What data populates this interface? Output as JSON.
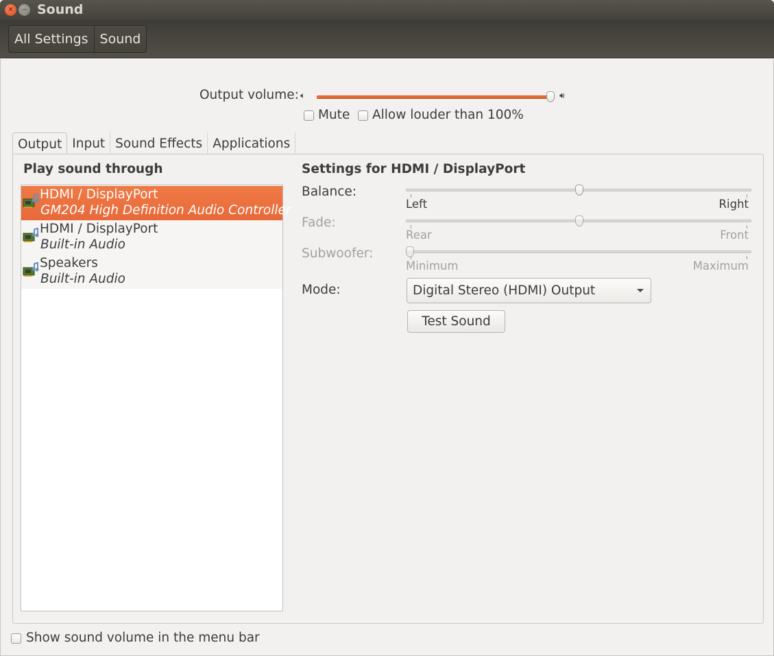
{
  "window": {
    "title": "Sound",
    "close_icon": "close-icon",
    "minimize_icon": "minimize-icon"
  },
  "toolbar": {
    "breadcrumbs": [
      "All Settings",
      "Sound"
    ]
  },
  "volume": {
    "label": "Output volume:",
    "value_percent": 100,
    "low_icon": "speaker-low-icon",
    "high_icon": "speaker-high-icon",
    "mute_label": "Mute",
    "mute_checked": false,
    "allow_louder_label": "Allow louder than 100%",
    "allow_louder_checked": false
  },
  "tabs": [
    {
      "label": "Output",
      "active": true
    },
    {
      "label": "Input",
      "active": false
    },
    {
      "label": "Sound Effects",
      "active": false
    },
    {
      "label": "Applications",
      "active": false
    }
  ],
  "output": {
    "list_heading": "Play sound through",
    "devices": [
      {
        "name": "HDMI / DisplayPort",
        "description": "GM204 High Definition Audio Controller",
        "selected": true,
        "icon": "sound-card-icon"
      },
      {
        "name": "HDMI / DisplayPort",
        "description": "Built-in Audio",
        "selected": false,
        "icon": "sound-card-icon"
      },
      {
        "name": "Speakers",
        "description": "Built-in Audio",
        "selected": false,
        "icon": "sound-card-icon"
      }
    ],
    "settings_heading": "Settings for HDMI / DisplayPort",
    "balance": {
      "label": "Balance:",
      "min_label": "Left",
      "max_label": "Right",
      "value_fraction": 0.5,
      "enabled": true
    },
    "fade": {
      "label": "Fade:",
      "min_label": "Rear",
      "max_label": "Front",
      "value_fraction": 0.5,
      "enabled": false
    },
    "subwoofer": {
      "label": "Subwoofer:",
      "min_label": "Minimum",
      "max_label": "Maximum",
      "value_fraction": 0.0,
      "enabled": false
    },
    "mode_label": "Mode:",
    "mode_value": "Digital Stereo (HDMI) Output",
    "test_sound_label": "Test Sound"
  },
  "footer": {
    "show_volume_label": "Show sound volume in the menu bar",
    "show_volume_checked": false
  },
  "colors": {
    "accent": "#e8693a",
    "titlebar": "#4a4741",
    "background": "#f2f1f0"
  }
}
